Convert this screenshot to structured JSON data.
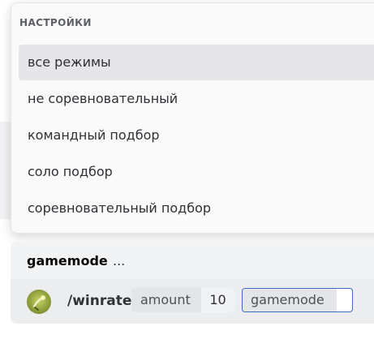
{
  "autocomplete": {
    "title": "НАСТРОЙКИ",
    "options": [
      {
        "label": "все режимы",
        "selected": true
      },
      {
        "label": "не соревновательный",
        "selected": false
      },
      {
        "label": "командный подбор",
        "selected": false
      },
      {
        "label": "соло подбор",
        "selected": false
      },
      {
        "label": "соревновательный подбор",
        "selected": false
      }
    ]
  },
  "option_hint": {
    "name": "gamemode",
    "ellipsis": "..."
  },
  "composer": {
    "avatar_icon": "user-avatar-icon",
    "command": "/winrate",
    "args": [
      {
        "label": "amount",
        "value": "10"
      },
      {
        "label": "gamemode",
        "value": ""
      }
    ]
  },
  "colors": {
    "accent_border": "#3a6cc4",
    "selected_option_bg": "#e6e6e8"
  }
}
